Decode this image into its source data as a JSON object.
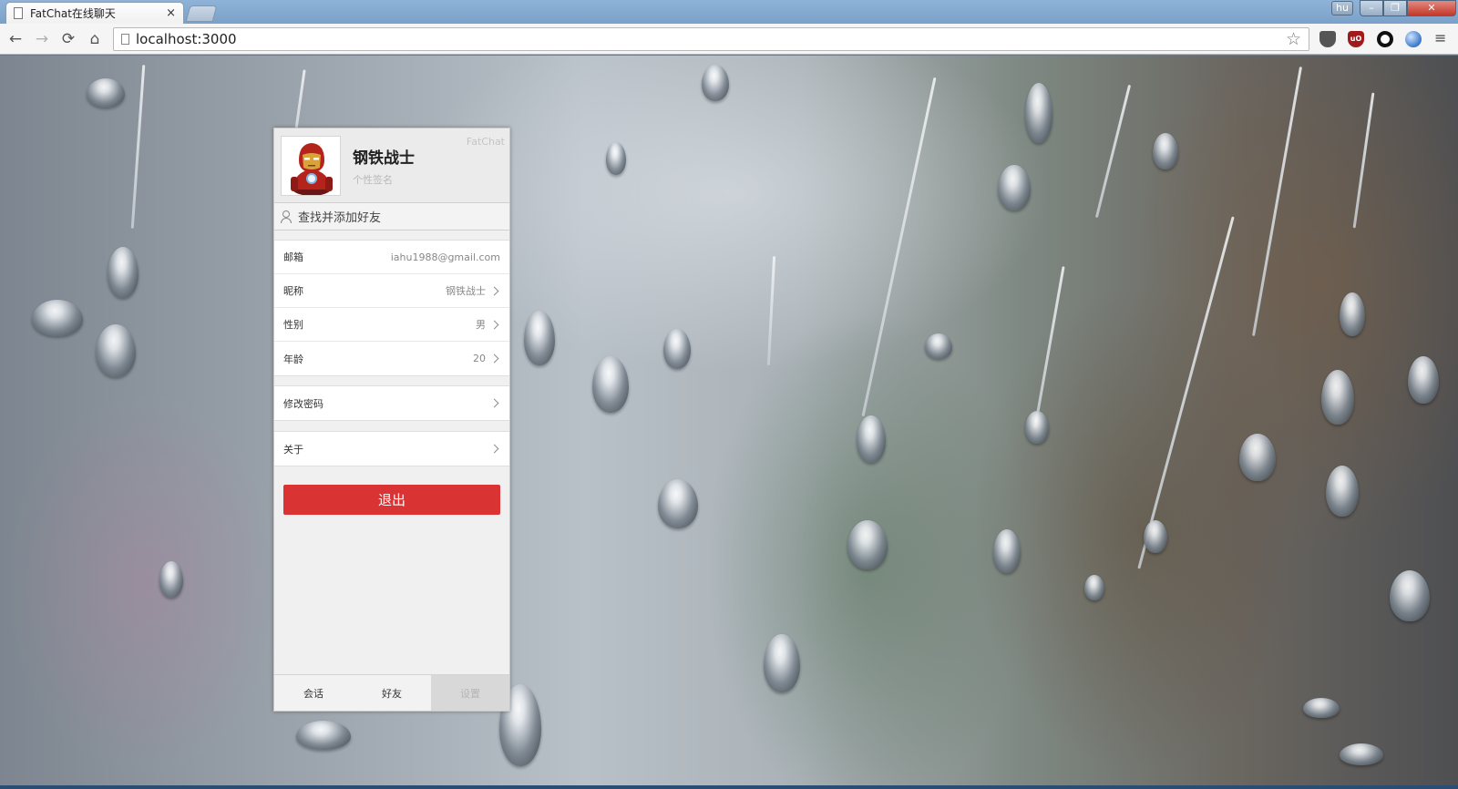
{
  "browser": {
    "tab_title": "FatChat在线聊天",
    "tab_close": "×",
    "url": "localhost:3000",
    "user_badge": "hu",
    "window_buttons": {
      "minimize": "–",
      "maximize": "❐",
      "close": "✕"
    },
    "nav": {
      "back": "←",
      "forward": "→",
      "reload": "⟳",
      "home": "⌂",
      "star": "☆",
      "menu": "≡"
    },
    "extensions": [
      "pocket-icon",
      "ublock-icon",
      "ring-icon",
      "globe-icon"
    ],
    "ublock_text": "uO"
  },
  "app": {
    "brand": "FatChat",
    "profile": {
      "nickname": "钢铁战士",
      "signature_placeholder": "个性签名",
      "avatar": "iron-man-avatar"
    },
    "search": {
      "placeholder": "查找并添加好友"
    },
    "info": [
      {
        "label": "邮箱",
        "value": "iahu1988@gmail.com"
      },
      {
        "label": "昵称",
        "value": "钢铁战士"
      },
      {
        "label": "性别",
        "value": "男"
      },
      {
        "label": "年龄",
        "value": "20"
      }
    ],
    "change_password": "修改密码",
    "about": "关于",
    "logout": "退出",
    "tabs": [
      {
        "label": "会话"
      },
      {
        "label": "好友"
      },
      {
        "label": "设置"
      }
    ],
    "colors": {
      "logout": "#d93333",
      "panel_bg": "#f0f0f0"
    }
  }
}
